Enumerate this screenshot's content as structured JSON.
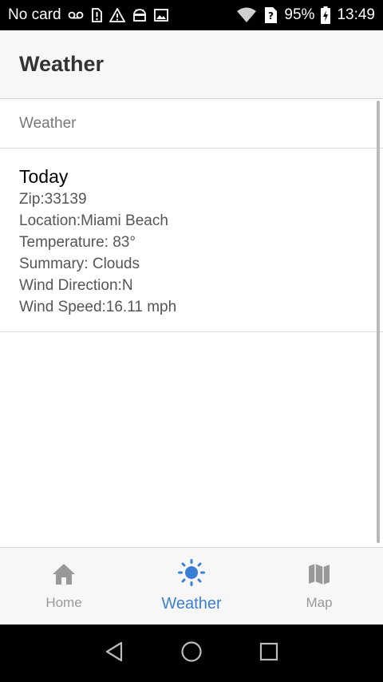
{
  "status_bar": {
    "carrier": "No card",
    "battery": "95%",
    "time": "13:49"
  },
  "app_bar": {
    "title": "Weather"
  },
  "list": {
    "header": "Weather",
    "card": {
      "title": "Today",
      "lines": [
        "Zip:33139",
        "Location:Miami Beach",
        "Temperature: 83°",
        "Summary: Clouds",
        "Wind Direction:N",
        "Wind Speed:16.11 mph"
      ]
    }
  },
  "tabs": [
    {
      "label": "Home",
      "icon": "home-icon"
    },
    {
      "label": "Weather",
      "icon": "sun-icon",
      "active": true
    },
    {
      "label": "Map",
      "icon": "map-icon"
    }
  ],
  "colors": {
    "accent": "#3a7fd5",
    "inactive": "#999999"
  }
}
